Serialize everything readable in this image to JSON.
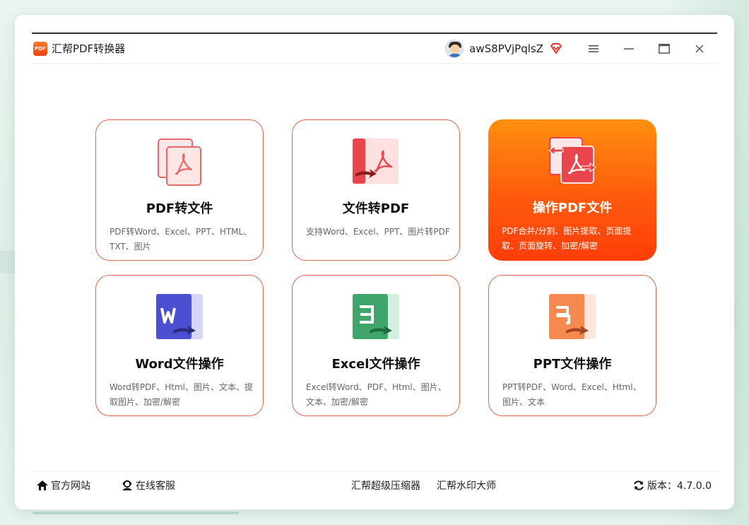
{
  "app": {
    "title": "汇帮PDF转换器",
    "logo_text": "PDF"
  },
  "user": {
    "name": "awS8PVjPqlsZ"
  },
  "window_controls": {
    "icons": [
      "menu-icon",
      "minimize-icon",
      "maximize-icon",
      "close-icon"
    ]
  },
  "cards": [
    {
      "title": "PDF转文件",
      "desc": "PDF转Word、Excel、PPT、HTML、TXT、图片",
      "icon": "pdf-to-file-icon",
      "active": false
    },
    {
      "title": "文件转PDF",
      "desc": "支持Word、Excel、PPT、图片转PDF",
      "icon": "file-to-pdf-icon",
      "active": false
    },
    {
      "title": "操作PDF文件",
      "desc": "PDF合并/分割、图片提取、页面提取、页面旋转、加密/解密",
      "icon": "operate-pdf-icon",
      "active": true
    },
    {
      "title": "Word文件操作",
      "desc": "Word转PDF、Html、图片、文本、提取图片、加密/解密",
      "icon": "word-icon",
      "active": false
    },
    {
      "title": "Excel文件操作",
      "desc": "Excel转Word、PDF、Html、图片、文本、加密/解密",
      "icon": "excel-icon",
      "active": false
    },
    {
      "title": "PPT文件操作",
      "desc": "PPT转PDF、Word、Excel、Html、图片、文本",
      "icon": "ppt-icon",
      "active": false
    }
  ],
  "footer": {
    "website": "官方网站",
    "support": "在线客服",
    "compressor": "汇帮超级压缩器",
    "watermark": "汇帮水印大师",
    "version": "版本：4.7.0.0"
  },
  "colors": {
    "accent_orange": "#ff5a0c",
    "card_border": "#d9684b",
    "pdf_red": "#e94b55",
    "word_blue": "#4b4fd1",
    "excel_green": "#2f9a5d",
    "ppt_orange": "#f58a4b"
  }
}
